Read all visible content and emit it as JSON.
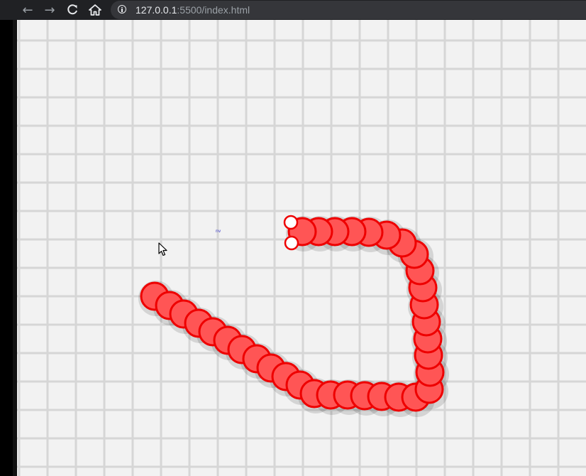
{
  "browser": {
    "url_host": "127.0.0.1",
    "url_rest": ":5500/index.html",
    "buttons": {
      "back": "back-arrow-icon",
      "forward": "forward-arrow-icon",
      "reload": "reload-icon",
      "home": "home-icon",
      "info": "info-icon"
    }
  },
  "game": {
    "background_color": "#f2f2f2",
    "grid_color": "#d6d6d6",
    "snake": {
      "fill": "#ff5555",
      "stroke": "#ee0000",
      "shadow": "rgba(0,0,0,0.12)",
      "eye_fill": "#ffffff"
    },
    "tiny_label": "nv"
  }
}
